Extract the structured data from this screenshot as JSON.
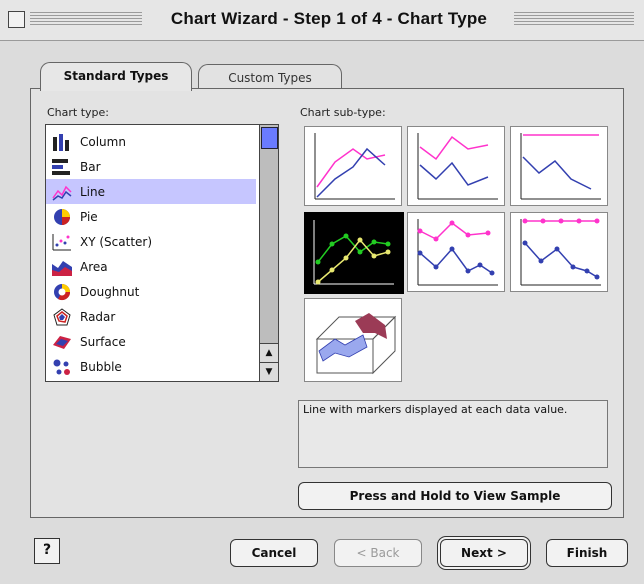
{
  "window": {
    "title": "Chart Wizard - Step 1 of 4 - Chart Type"
  },
  "tabs": [
    {
      "label": "Standard Types",
      "active": true
    },
    {
      "label": "Custom Types",
      "active": false
    }
  ],
  "chart_type_label": "Chart type:",
  "chart_subtype_label": "Chart sub-type:",
  "chart_types": [
    {
      "label": "Column",
      "icon": "column-chart-icon"
    },
    {
      "label": "Bar",
      "icon": "bar-chart-icon"
    },
    {
      "label": "Line",
      "icon": "line-chart-icon",
      "selected": true
    },
    {
      "label": "Pie",
      "icon": "pie-chart-icon"
    },
    {
      "label": "XY (Scatter)",
      "icon": "scatter-chart-icon"
    },
    {
      "label": "Area",
      "icon": "area-chart-icon"
    },
    {
      "label": "Doughnut",
      "icon": "doughnut-chart-icon"
    },
    {
      "label": "Radar",
      "icon": "radar-chart-icon"
    },
    {
      "label": "Surface",
      "icon": "surface-chart-icon"
    },
    {
      "label": "Bubble",
      "icon": "bubble-chart-icon"
    }
  ],
  "subtype_description": "Line with markers displayed at each data value.",
  "buttons": {
    "sample": "Press and Hold to View Sample",
    "cancel": "Cancel",
    "back": "< Back",
    "next": "Next >",
    "finish": "Finish",
    "help": "?"
  },
  "colors": {
    "accent_selection": "#c6c6ff",
    "scroll_thumb": "#6a7bff",
    "series_pink": "#ff33cc",
    "series_blue": "#3340b0",
    "series_green": "#22cc22",
    "series_yellow": "#e8e870"
  }
}
